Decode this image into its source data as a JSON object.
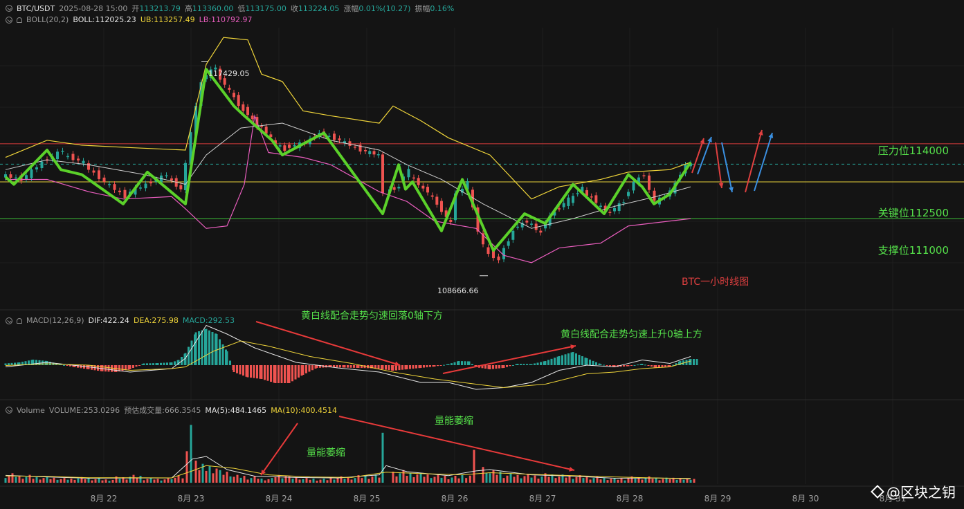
{
  "header": {
    "symbol": "BTC/USDT",
    "datetime": "2025-08-28 15:00",
    "open_label": "开",
    "open": "113213.79",
    "high_label": "高",
    "high": "113360.00",
    "low_label": "低",
    "low": "113175.00",
    "close_label": "收",
    "close": "113224.05",
    "change_label": "涨幅",
    "change": "0.01%(10.27)",
    "amp_label": "振幅",
    "amp": "0.16%"
  },
  "boll": {
    "label": "BOLL(20,2)",
    "mid": "BOLL:112025.23",
    "ub": "UB:113257.49",
    "lb": "LB:110792.97"
  },
  "macd": {
    "label": "MACD(12,26,9)",
    "dif": "DIF:422.24",
    "dea": "DEA:275.98",
    "macd": "MACD:292.53"
  },
  "volume": {
    "label": "Volume",
    "vol": "VOLUME:253.0296",
    "est": "预估成交量:666.3545",
    "ma5": "MA(5):484.1465",
    "ma10": "MA(10):400.4514"
  },
  "levels": {
    "resistance": "压力位114000",
    "key": "关键位112500",
    "support": "支撑位111000"
  },
  "annotations": {
    "chart_title": "BTC一小时线图",
    "macd_down": "黄白线配合走势匀速回落0轴下方",
    "macd_up": "黄白线配合走势匀速上升0轴上方",
    "vol_shrink_1": "量能萎缩",
    "vol_shrink_2": "量能萎缩",
    "high_price": "117429.05",
    "low_price": "108666.66"
  },
  "x_axis": [
    "8月 22",
    "8月 23",
    "8月 24",
    "8月 25",
    "8月 26",
    "8月 27",
    "8月 28",
    "8月 29",
    "8月 30",
    "8月 31"
  ],
  "watermark": "@区块之钥",
  "colors": {
    "up": "#26a69a",
    "down": "#ef5350",
    "ub": "#f0d53a",
    "lb": "#e85dbd",
    "mid": "#cfcfcf",
    "zigzag": "#5bd12a",
    "resistance": "#d43a3a",
    "key": "#e8d23a",
    "support": "#3fc23a"
  },
  "chart_data": {
    "type": "candlestick",
    "interval": "1h",
    "price_range": [
      107500,
      118800
    ],
    "levels": [
      114000,
      112500,
      111000
    ],
    "zigzag_path": [
      [
        0,
        112700
      ],
      [
        12,
        112400
      ],
      [
        60,
        113800
      ],
      [
        80,
        113000
      ],
      [
        110,
        112800
      ],
      [
        145,
        112100
      ],
      [
        170,
        111600
      ],
      [
        205,
        112900
      ],
      [
        260,
        111600
      ],
      [
        290,
        117100
      ],
      [
        330,
        115600
      ],
      [
        345,
        115200
      ],
      [
        385,
        114200
      ],
      [
        400,
        113600
      ],
      [
        460,
        114500
      ],
      [
        545,
        111200
      ],
      [
        568,
        113200
      ],
      [
        578,
        112200
      ],
      [
        588,
        112500
      ],
      [
        630,
        110500
      ],
      [
        660,
        112600
      ],
      [
        705,
        109700
      ],
      [
        750,
        111200
      ],
      [
        780,
        110800
      ],
      [
        820,
        112400
      ],
      [
        865,
        111200
      ],
      [
        900,
        112800
      ],
      [
        920,
        112300
      ],
      [
        937,
        111600
      ],
      [
        960,
        112000
      ],
      [
        990,
        113300
      ]
    ],
    "boll_ub": [
      [
        0,
        113500
      ],
      [
        60,
        114200
      ],
      [
        110,
        114000
      ],
      [
        180,
        113900
      ],
      [
        260,
        113800
      ],
      [
        290,
        117300
      ],
      [
        315,
        118400
      ],
      [
        350,
        118300
      ],
      [
        370,
        116900
      ],
      [
        400,
        116600
      ],
      [
        430,
        115400
      ],
      [
        470,
        115200
      ],
      [
        540,
        114900
      ],
      [
        560,
        115600
      ],
      [
        600,
        115000
      ],
      [
        640,
        114300
      ],
      [
        700,
        113600
      ],
      [
        760,
        111800
      ],
      [
        800,
        112300
      ],
      [
        860,
        112600
      ],
      [
        900,
        112900
      ],
      [
        960,
        113000
      ],
      [
        990,
        113300
      ]
    ],
    "boll_lb": [
      [
        0,
        112600
      ],
      [
        60,
        112600
      ],
      [
        120,
        112100
      ],
      [
        170,
        111800
      ],
      [
        240,
        111900
      ],
      [
        260,
        111400
      ],
      [
        290,
        110600
      ],
      [
        320,
        110700
      ],
      [
        345,
        112400
      ],
      [
        360,
        115200
      ],
      [
        380,
        113700
      ],
      [
        430,
        113500
      ],
      [
        470,
        113200
      ],
      [
        540,
        112100
      ],
      [
        580,
        111700
      ],
      [
        620,
        110900
      ],
      [
        680,
        110600
      ],
      [
        720,
        109500
      ],
      [
        760,
        109200
      ],
      [
        800,
        109800
      ],
      [
        860,
        110000
      ],
      [
        900,
        110700
      ],
      [
        960,
        110900
      ],
      [
        990,
        111000
      ]
    ],
    "boll_mid": [
      [
        0,
        113000
      ],
      [
        60,
        113400
      ],
      [
        120,
        113200
      ],
      [
        200,
        112800
      ],
      [
        260,
        112400
      ],
      [
        290,
        113600
      ],
      [
        340,
        114700
      ],
      [
        400,
        114900
      ],
      [
        470,
        114200
      ],
      [
        540,
        113800
      ],
      [
        580,
        113200
      ],
      [
        630,
        112600
      ],
      [
        690,
        111600
      ],
      [
        760,
        110600
      ],
      [
        820,
        111000
      ],
      [
        880,
        111500
      ],
      [
        940,
        111900
      ],
      [
        990,
        112300
      ]
    ],
    "candles_summary": [
      [
        0,
        112800,
        112600
      ],
      [
        30,
        112600,
        113300
      ],
      [
        60,
        113300,
        113800
      ],
      [
        90,
        113600,
        113300
      ],
      [
        120,
        113200,
        112500
      ],
      [
        150,
        112500,
        111900
      ],
      [
        180,
        112000,
        112400
      ],
      [
        210,
        112400,
        112800
      ],
      [
        240,
        112700,
        112200
      ],
      [
        260,
        112100,
        114500
      ],
      [
        275,
        114500,
        116600
      ],
      [
        290,
        116700,
        117200
      ],
      [
        310,
        117000,
        116200
      ],
      [
        330,
        116200,
        115400
      ],
      [
        350,
        115500,
        114800
      ],
      [
        370,
        114900,
        114300
      ],
      [
        390,
        114200,
        113800
      ],
      [
        410,
        113900,
        114100
      ],
      [
        440,
        114100,
        114500
      ],
      [
        460,
        114500,
        114200
      ],
      [
        490,
        114200,
        113800
      ],
      [
        520,
        113800,
        113600
      ],
      [
        545,
        113500,
        112100
      ],
      [
        555,
        112100,
        112300
      ],
      [
        575,
        112500,
        113000
      ],
      [
        590,
        112800,
        112200
      ],
      [
        610,
        112300,
        111600
      ],
      [
        630,
        111600,
        110800
      ],
      [
        650,
        111000,
        112000
      ],
      [
        660,
        112000,
        112500
      ],
      [
        675,
        112300,
        110500
      ],
      [
        690,
        110400,
        109500
      ],
      [
        705,
        109600,
        109300
      ],
      [
        720,
        109400,
        110500
      ],
      [
        740,
        110600,
        110900
      ],
      [
        760,
        110900,
        110400
      ],
      [
        780,
        110600,
        111300
      ],
      [
        800,
        111300,
        111800
      ],
      [
        820,
        111700,
        112300
      ],
      [
        840,
        112100,
        111700
      ],
      [
        860,
        111600,
        111200
      ],
      [
        880,
        111300,
        111700
      ],
      [
        900,
        111800,
        112500
      ],
      [
        915,
        112500,
        112800
      ],
      [
        930,
        112700,
        111700
      ],
      [
        945,
        111700,
        111900
      ],
      [
        960,
        111900,
        112400
      ],
      [
        975,
        112500,
        113200
      ],
      [
        990,
        113200,
        113224
      ]
    ],
    "macd_hist": [
      [
        0,
        50
      ],
      [
        20,
        80
      ],
      [
        40,
        160
      ],
      [
        60,
        120
      ],
      [
        80,
        20
      ],
      [
        100,
        -60
      ],
      [
        120,
        -120
      ],
      [
        140,
        -180
      ],
      [
        160,
        -200
      ],
      [
        180,
        -120
      ],
      [
        200,
        50
      ],
      [
        220,
        60
      ],
      [
        240,
        80
      ],
      [
        250,
        150
      ],
      [
        260,
        350
      ],
      [
        275,
        950
      ],
      [
        290,
        1050
      ],
      [
        305,
        900
      ],
      [
        320,
        400
      ],
      [
        330,
        -200
      ],
      [
        350,
        -350
      ],
      [
        370,
        -400
      ],
      [
        390,
        -520
      ],
      [
        410,
        -520
      ],
      [
        430,
        -280
      ],
      [
        450,
        -80
      ],
      [
        470,
        -60
      ],
      [
        490,
        -70
      ],
      [
        510,
        -80
      ],
      [
        530,
        -90
      ],
      [
        545,
        -120
      ],
      [
        560,
        -160
      ],
      [
        580,
        -120
      ],
      [
        600,
        -80
      ],
      [
        620,
        -40
      ],
      [
        640,
        30
      ],
      [
        655,
        120
      ],
      [
        670,
        110
      ],
      [
        680,
        -60
      ],
      [
        700,
        -120
      ],
      [
        720,
        -80
      ],
      [
        740,
        40
      ],
      [
        760,
        30
      ],
      [
        780,
        120
      ],
      [
        800,
        260
      ],
      [
        820,
        380
      ],
      [
        840,
        200
      ],
      [
        860,
        30
      ],
      [
        880,
        -60
      ],
      [
        900,
        -30
      ],
      [
        920,
        40
      ],
      [
        940,
        -80
      ],
      [
        960,
        -40
      ],
      [
        975,
        120
      ],
      [
        990,
        180
      ]
    ],
    "macd_dif": [
      [
        0,
        -50
      ],
      [
        60,
        80
      ],
      [
        120,
        -50
      ],
      [
        180,
        -200
      ],
      [
        240,
        -100
      ],
      [
        260,
        200
      ],
      [
        290,
        1150
      ],
      [
        320,
        900
      ],
      [
        360,
        500
      ],
      [
        420,
        80
      ],
      [
        480,
        -80
      ],
      [
        540,
        -200
      ],
      [
        600,
        -500
      ],
      [
        640,
        -500
      ],
      [
        680,
        -700
      ],
      [
        720,
        -650
      ],
      [
        760,
        -500
      ],
      [
        800,
        -150
      ],
      [
        840,
        0
      ],
      [
        880,
        -50
      ],
      [
        920,
        150
      ],
      [
        960,
        50
      ],
      [
        990,
        250
      ]
    ],
    "macd_dea": [
      [
        0,
        -10
      ],
      [
        60,
        40
      ],
      [
        120,
        0
      ],
      [
        180,
        -150
      ],
      [
        240,
        -100
      ],
      [
        260,
        -50
      ],
      [
        300,
        400
      ],
      [
        340,
        700
      ],
      [
        380,
        550
      ],
      [
        440,
        250
      ],
      [
        500,
        50
      ],
      [
        560,
        -200
      ],
      [
        620,
        -400
      ],
      [
        680,
        -550
      ],
      [
        720,
        -650
      ],
      [
        780,
        -550
      ],
      [
        840,
        -250
      ],
      [
        880,
        -200
      ],
      [
        920,
        -100
      ],
      [
        960,
        -50
      ],
      [
        990,
        120
      ]
    ],
    "volume_bars": [
      [
        0,
        300
      ],
      [
        20,
        250
      ],
      [
        40,
        200
      ],
      [
        60,
        180
      ],
      [
        80,
        150
      ],
      [
        100,
        180
      ],
      [
        120,
        150
      ],
      [
        140,
        120
      ],
      [
        160,
        200
      ],
      [
        180,
        250
      ],
      [
        200,
        160
      ],
      [
        220,
        140
      ],
      [
        240,
        180
      ],
      [
        250,
        220
      ],
      [
        262,
        1200
      ],
      [
        268,
        2200
      ],
      [
        275,
        800
      ],
      [
        290,
        600
      ],
      [
        310,
        400
      ],
      [
        330,
        250
      ],
      [
        350,
        200
      ],
      [
        370,
        150
      ],
      [
        390,
        280
      ],
      [
        410,
        200
      ],
      [
        430,
        150
      ],
      [
        450,
        130
      ],
      [
        470,
        200
      ],
      [
        490,
        200
      ],
      [
        510,
        240
      ],
      [
        530,
        260
      ],
      [
        545,
        1900
      ],
      [
        560,
        400
      ],
      [
        580,
        350
      ],
      [
        600,
        300
      ],
      [
        620,
        250
      ],
      [
        640,
        220
      ],
      [
        660,
        300
      ],
      [
        677,
        1250
      ],
      [
        690,
        500
      ],
      [
        700,
        400
      ],
      [
        720,
        300
      ],
      [
        740,
        280
      ],
      [
        760,
        260
      ],
      [
        780,
        300
      ],
      [
        800,
        260
      ],
      [
        820,
        240
      ],
      [
        840,
        200
      ],
      [
        860,
        170
      ],
      [
        880,
        150
      ],
      [
        900,
        200
      ],
      [
        920,
        200
      ],
      [
        940,
        160
      ],
      [
        960,
        180
      ],
      [
        975,
        150
      ],
      [
        990,
        120
      ]
    ],
    "volume_ma5": [
      [
        0,
        280
      ],
      [
        60,
        220
      ],
      [
        120,
        170
      ],
      [
        180,
        180
      ],
      [
        240,
        180
      ],
      [
        270,
        900
      ],
      [
        290,
        1000
      ],
      [
        320,
        500
      ],
      [
        360,
        250
      ],
      [
        420,
        200
      ],
      [
        480,
        180
      ],
      [
        540,
        300
      ],
      [
        550,
        650
      ],
      [
        580,
        420
      ],
      [
        640,
        270
      ],
      [
        680,
        450
      ],
      [
        700,
        500
      ],
      [
        760,
        300
      ],
      [
        820,
        250
      ],
      [
        880,
        170
      ],
      [
        940,
        180
      ],
      [
        990,
        140
      ]
    ],
    "volume_ma10": [
      [
        0,
        260
      ],
      [
        60,
        240
      ],
      [
        120,
        190
      ],
      [
        180,
        190
      ],
      [
        240,
        185
      ],
      [
        270,
        450
      ],
      [
        290,
        650
      ],
      [
        330,
        550
      ],
      [
        380,
        300
      ],
      [
        440,
        220
      ],
      [
        500,
        200
      ],
      [
        550,
        400
      ],
      [
        600,
        350
      ],
      [
        660,
        300
      ],
      [
        700,
        380
      ],
      [
        760,
        320
      ],
      [
        820,
        270
      ],
      [
        880,
        220
      ],
      [
        940,
        180
      ],
      [
        990,
        160
      ]
    ]
  }
}
